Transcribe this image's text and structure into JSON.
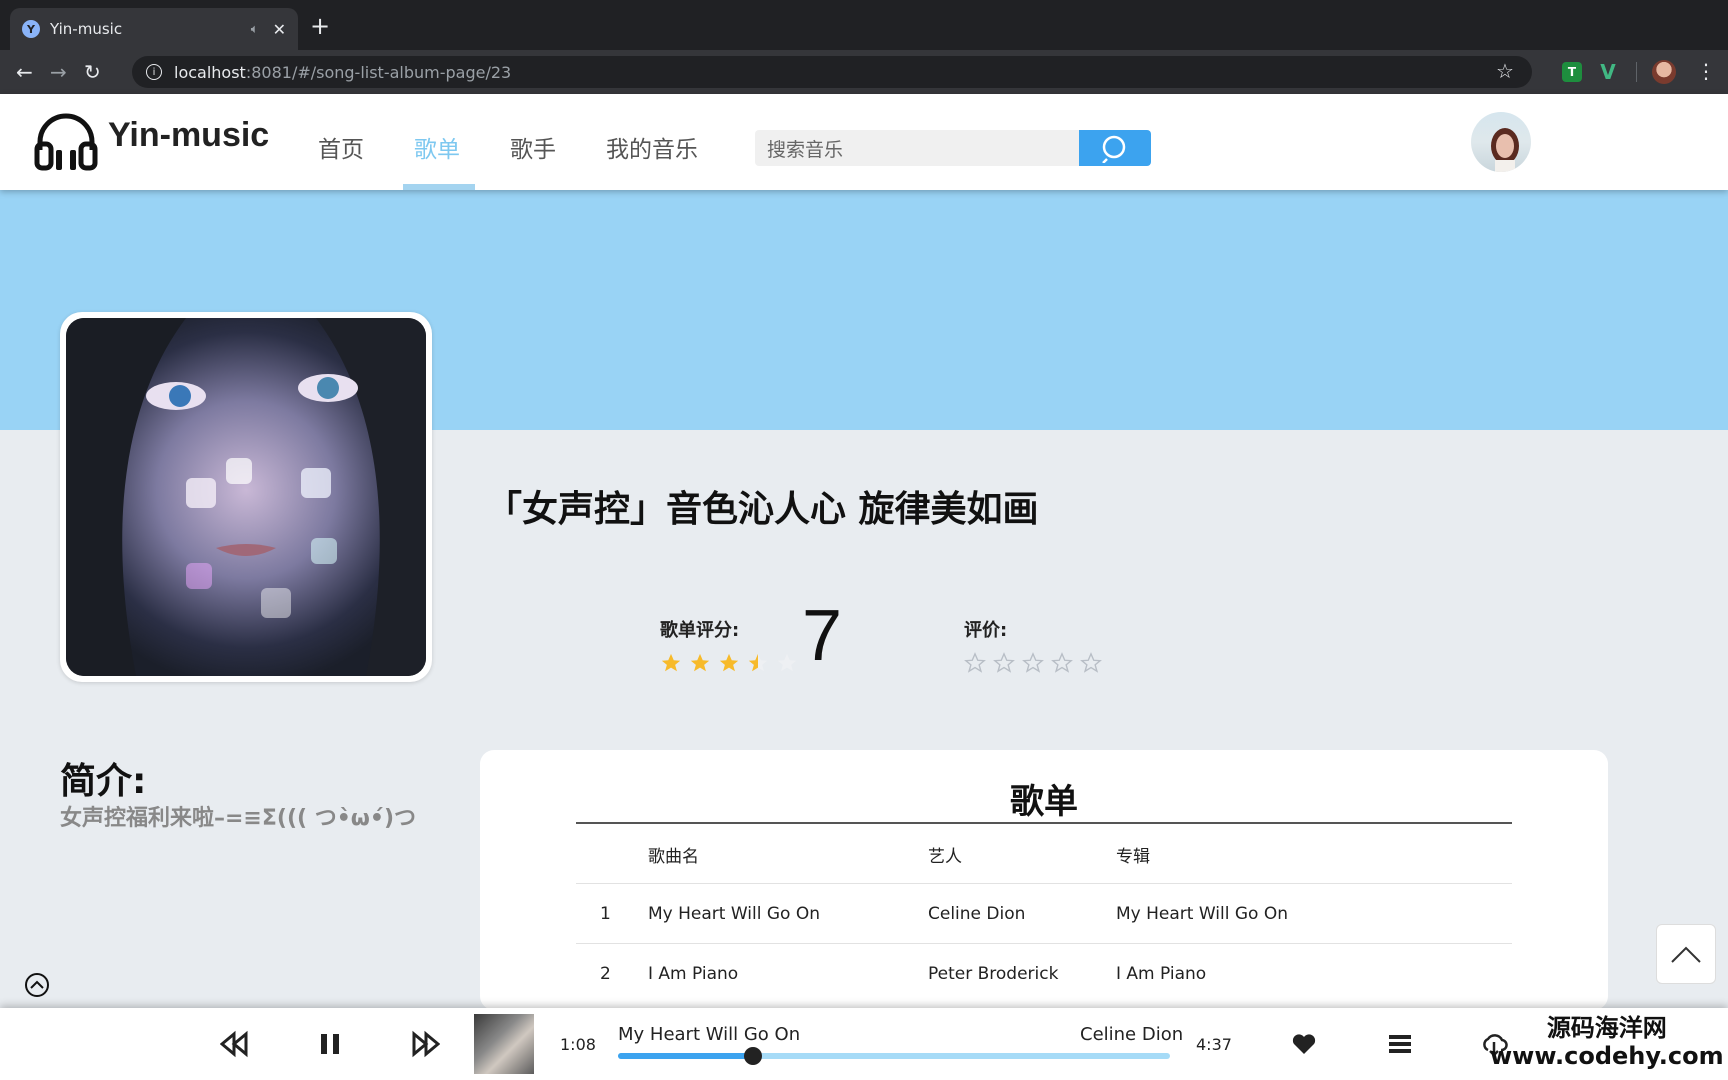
{
  "browser": {
    "tab_title": "Yin-music",
    "tab_favicon": "Y",
    "url_host": "localhost",
    "url_path": ":8081/#/song-list-album-page/23"
  },
  "header": {
    "logo_text": "Yin-music",
    "nav": [
      "首页",
      "歌单",
      "歌手",
      "我的音乐"
    ],
    "active_nav": "歌单",
    "search_placeholder": "搜索音乐"
  },
  "playlist": {
    "title": "「女声控」音色沁人心 旋律美如画",
    "score_label": "歌单评分:",
    "score": "7",
    "score_stars": 3.5,
    "review_label": "评价:",
    "review_stars": 0,
    "intro_title": "简介:",
    "intro_text": "女声控福利来啦–=≡Σ((( つ•̀ω•́)つ"
  },
  "song_list": {
    "heading": "歌单",
    "columns": [
      "歌曲名",
      "艺人",
      "专辑"
    ],
    "rows": [
      {
        "index": "1",
        "name": "My Heart Will Go On",
        "artist": "Celine Dion",
        "album": "My Heart Will Go On"
      },
      {
        "index": "2",
        "name": "I Am Piano",
        "artist": "Peter Broderick",
        "album": "I Am Piano"
      }
    ]
  },
  "player": {
    "current_time": "1:08",
    "total_time": "4:37",
    "song": "My Heart Will Go On",
    "artist": "Celine Dion",
    "progress": 0.245
  },
  "watermark": {
    "line1": "源码海洋网",
    "line2": "www.codehy.com"
  },
  "colors": {
    "accent": "#3ca3ef",
    "banner": "#99d3f5",
    "star": "#f7ba2a"
  }
}
